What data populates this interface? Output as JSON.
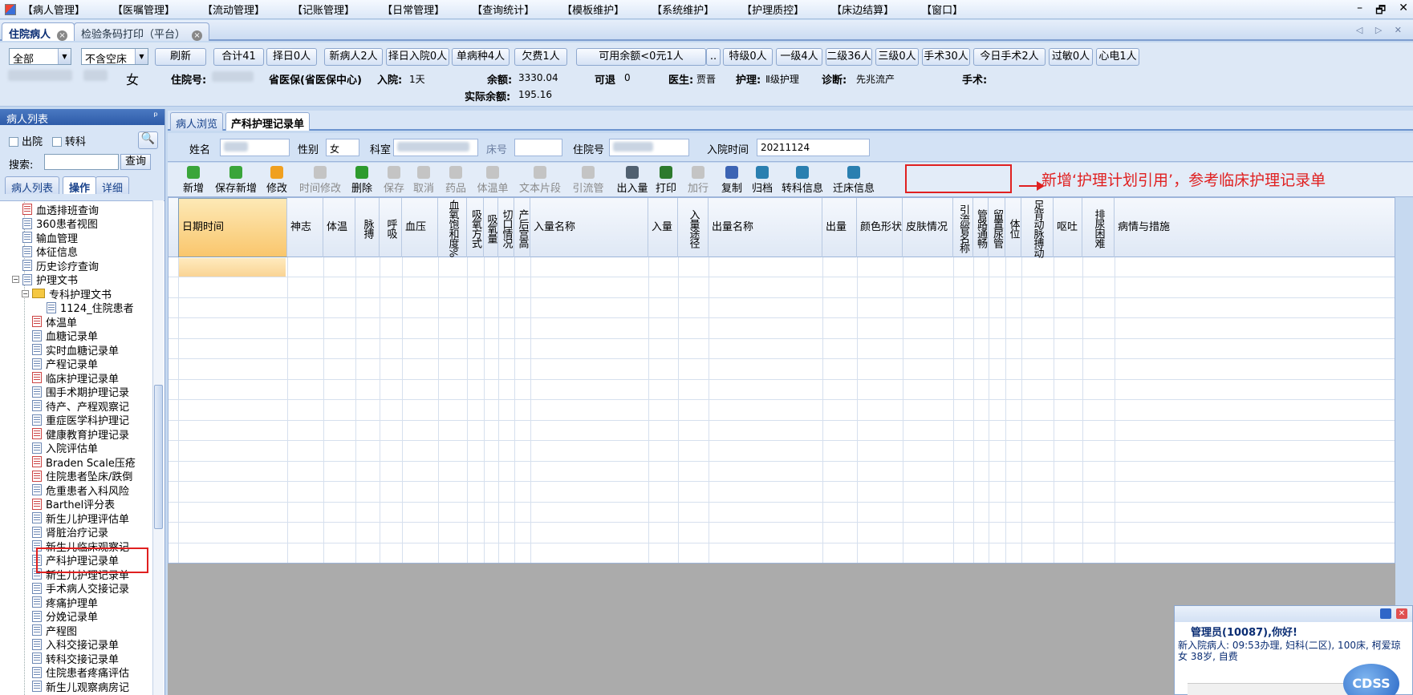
{
  "menu": [
    "【病人管理】",
    "【医嘱管理】",
    "【流动管理】",
    "【记账管理】",
    "【日常管理】",
    "【查询统计】",
    "【模板维护】",
    "【系统维护】",
    "【护理质控】",
    "【床边结算】",
    "【窗口】"
  ],
  "window_controls": {
    "min": "–",
    "restore": "🗗",
    "close": "✕"
  },
  "doc_tabs": [
    {
      "label": "住院病人",
      "active": true
    },
    {
      "label": "检验条码打印（平台）",
      "active": false
    }
  ],
  "tab_nav": "◁ ▷ ✕",
  "filters": {
    "scope": "全部",
    "bed": "不含空床"
  },
  "filter_buttons": [
    "刷新",
    "合计41",
    "择日0人",
    "新病人2人",
    "择日入院0人",
    "单病种4人",
    "欠费1人",
    "可用余额<0元1人",
    "..",
    "特级0人",
    "一级4人",
    "二级36人",
    "三级0人",
    "手术30人",
    "今日手术2人",
    "过敏0人",
    "心电1人"
  ],
  "patient_header": {
    "sex": "女",
    "inpatient_no_label": "住院号:",
    "insurance": "省医保(省医保中心)",
    "admit_label": "入院:",
    "admit_value": "1天",
    "balance_label": "余额:",
    "balance_value": "3330.04",
    "actual_label": "实际余额:",
    "actual_value": "195.16",
    "refund_label": "可退",
    "refund_value": "0",
    "doctor_label": "医生:",
    "doctor_value": "贾晋",
    "nursing_label": "护理:",
    "nursing_value": "Ⅱ级护理",
    "diag_label": "诊断:",
    "diag_value": "先兆流产",
    "surgery_label": "手术:"
  },
  "left_panel": {
    "title": "病人列表",
    "pin": "ᵖ",
    "discharged": "出院",
    "transfer": "转科",
    "search_label": "搜索:",
    "query_btn": "查询",
    "tabs": [
      {
        "label": "病人列表",
        "active": false
      },
      {
        "label": "操作",
        "active": true
      },
      {
        "label": "详细",
        "active": false
      }
    ],
    "tree": [
      {
        "label": "血透排班查询",
        "level": 1,
        "icon": "red"
      },
      {
        "label": "360患者视图",
        "level": 1,
        "icon": "blue"
      },
      {
        "label": "输血管理",
        "level": 1,
        "icon": "blue"
      },
      {
        "label": "体征信息",
        "level": 1,
        "icon": "blue"
      },
      {
        "label": "历史诊疗查询",
        "level": 1,
        "icon": "blue"
      },
      {
        "label": "护理文书",
        "level": 1,
        "icon": "blue",
        "exp": "−"
      },
      {
        "label": "专科护理文书",
        "level": 2,
        "icon": "folder",
        "exp": "−"
      },
      {
        "label": "1124_住院患者",
        "level": 3,
        "icon": "blue"
      },
      {
        "label": "体温单",
        "level": 2,
        "icon": "red"
      },
      {
        "label": "血糖记录单",
        "level": 2,
        "icon": "blue"
      },
      {
        "label": "实时血糖记录单",
        "level": 2,
        "icon": "blue"
      },
      {
        "label": "产程记录单",
        "level": 2,
        "icon": "blue"
      },
      {
        "label": "临床护理记录单",
        "level": 2,
        "icon": "red"
      },
      {
        "label": "围手术期护理记录",
        "level": 2,
        "icon": "blue"
      },
      {
        "label": "待产、产程观察记",
        "level": 2,
        "icon": "blue"
      },
      {
        "label": "重症医学科护理记",
        "level": 2,
        "icon": "blue"
      },
      {
        "label": "健康教育护理记录",
        "level": 2,
        "icon": "red"
      },
      {
        "label": "入院评估单",
        "level": 2,
        "icon": "blue"
      },
      {
        "label": "Braden Scale压疮",
        "level": 2,
        "icon": "red"
      },
      {
        "label": "住院患者坠床/跌倒",
        "level": 2,
        "icon": "red"
      },
      {
        "label": "危重患者入科风险",
        "level": 2,
        "icon": "blue"
      },
      {
        "label": "Barthel评分表",
        "level": 2,
        "icon": "red"
      },
      {
        "label": "新生儿护理评估单",
        "level": 2,
        "icon": "blue"
      },
      {
        "label": "肾脏治疗记录",
        "level": 2,
        "icon": "blue"
      },
      {
        "label": "新生儿临床观察记",
        "level": 2,
        "icon": "blue"
      },
      {
        "label": "产科护理记录单",
        "level": 2,
        "icon": "blue"
      },
      {
        "label": "新生儿护理记录单",
        "level": 2,
        "icon": "blue"
      },
      {
        "label": "手术病人交接记录",
        "level": 2,
        "icon": "blue"
      },
      {
        "label": "疼痛护理单",
        "level": 2,
        "icon": "blue"
      },
      {
        "label": "分娩记录单",
        "level": 2,
        "icon": "blue"
      },
      {
        "label": "产程图",
        "level": 2,
        "icon": "blue"
      },
      {
        "label": "入科交接记录单",
        "level": 2,
        "icon": "blue"
      },
      {
        "label": "转科交接记录单",
        "level": 2,
        "icon": "blue"
      },
      {
        "label": "住院患者疼痛评估",
        "level": 2,
        "icon": "blue"
      },
      {
        "label": "新生儿观察病房记",
        "level": 2,
        "icon": "blue"
      }
    ]
  },
  "main_tabs": [
    {
      "label": "病人浏览",
      "active": false
    },
    {
      "label": "产科护理记录单",
      "active": true
    }
  ],
  "patient_fields": {
    "name_label": "姓名",
    "sex_label": "性别",
    "sex_value": "女",
    "dept_label": "科室",
    "bed_label": "床号",
    "inpatient_label": "住院号",
    "admit_time_label": "入院时间",
    "admit_time_value": "20211124"
  },
  "toolbar": [
    {
      "label": "新增",
      "enabled": true,
      "color": "#3aa53a"
    },
    {
      "label": "保存新增",
      "enabled": true,
      "color": "#3aa53a"
    },
    {
      "label": "修改",
      "enabled": true,
      "color": "#f0a020"
    },
    {
      "label": "时间修改",
      "enabled": false
    },
    {
      "label": "删除",
      "enabled": true,
      "color": "#2e9b2e"
    },
    {
      "label": "保存",
      "enabled": false
    },
    {
      "label": "取消",
      "enabled": false
    },
    {
      "label": "药品",
      "enabled": false
    },
    {
      "label": "体温单",
      "enabled": false
    },
    {
      "label": "文本片段",
      "enabled": false
    },
    {
      "label": "引流管",
      "enabled": false
    },
    {
      "label": "出入量",
      "enabled": true,
      "color": "#506070"
    },
    {
      "label": "打印",
      "enabled": true,
      "color": "#2d7a2d"
    },
    {
      "label": "加行",
      "enabled": false
    },
    {
      "label": "复制",
      "enabled": true,
      "color": "#3c64b4"
    },
    {
      "label": "归档",
      "enabled": true,
      "color": "#2a7fb0"
    },
    {
      "label": "转科信息",
      "enabled": true,
      "color": "#2a7fb0"
    },
    {
      "label": "迁床信息",
      "enabled": true,
      "color": "#2a7fb0"
    }
  ],
  "annotation": "新增‘护理计划引用’，参考临床护理记录单",
  "grid_columns": [
    {
      "label": "日期时间",
      "vertical": false
    },
    {
      "label": "神志",
      "vertical": false
    },
    {
      "label": "体温",
      "vertical": false
    },
    {
      "label": "脉搏",
      "vertical": true
    },
    {
      "label": "呼吸",
      "vertical": true
    },
    {
      "label": "血压",
      "vertical": false
    },
    {
      "label": "血氧饱和度%",
      "vertical": true
    },
    {
      "label": "吸氧方式",
      "vertical": true
    },
    {
      "label": "吸氧量",
      "vertical": true
    },
    {
      "label": "切口情况",
      "vertical": true
    },
    {
      "label": "产后宫高",
      "vertical": true
    },
    {
      "label": "入量名称",
      "vertical": false
    },
    {
      "label": "入量",
      "vertical": false
    },
    {
      "label": "入量途径",
      "vertical": true
    },
    {
      "label": "出量名称",
      "vertical": false
    },
    {
      "label": "出量",
      "vertical": false
    },
    {
      "label": "颜色形状",
      "vertical": false
    },
    {
      "label": "皮肤情况",
      "vertical": false
    },
    {
      "label": "引流管名称",
      "vertical": true
    },
    {
      "label": "管路通畅",
      "vertical": true
    },
    {
      "label": "留置尿管",
      "vertical": true
    },
    {
      "label": "体位",
      "vertical": true
    },
    {
      "label": "足背动脉搏动",
      "vertical": true
    },
    {
      "label": "呕吐",
      "vertical": false
    },
    {
      "label": "排尿困难",
      "vertical": true
    },
    {
      "label": "病情与措施",
      "vertical": false
    }
  ],
  "popup": {
    "title": "管理员(10087),你好!",
    "message": "新入院病人: 09:53办理, 妇科(二区), 100床, 柯爱琼 女 38岁, 自费",
    "logo": "CDSS"
  }
}
